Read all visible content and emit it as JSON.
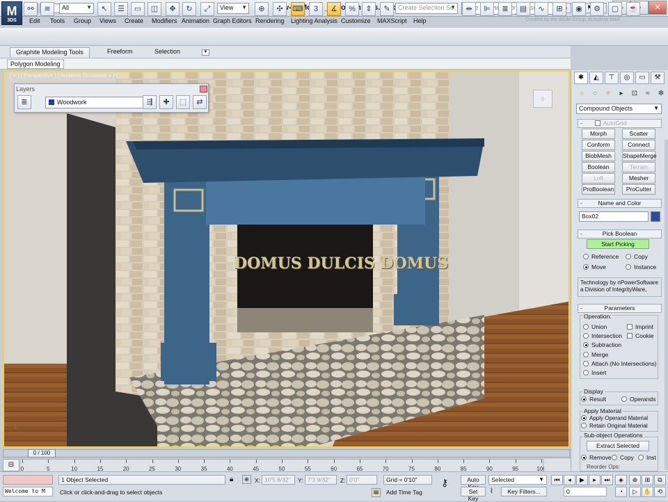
{
  "app": {
    "logo": "M",
    "logo_sub": "3DS",
    "title": "How-to Movie _ Boolean Ops.max",
    "search_placeholder": "Type a keyword or phrase",
    "credit": "Created by the WDM Group, Autodesk M&E"
  },
  "menu": [
    "Edit",
    "Tools",
    "Group",
    "Views",
    "Create",
    "Modifiers",
    "Animation",
    "Graph Editors",
    "Rendering",
    "Lighting Analysis",
    "Customize",
    "MAXScript",
    "Help"
  ],
  "toolbar": {
    "filter": "All",
    "ref_coord": "View",
    "snap_label": "3",
    "selection_set": "Create Selection Se"
  },
  "ribbon": {
    "tabs": [
      "Graphite Modeling Tools",
      "Freeform",
      "Selection"
    ],
    "sub": "Polygon Modeling"
  },
  "viewport": {
    "label": "[ + ] [ Perspective ] [ Ambient Occlusion + H",
    "sign": "DOMUS DULCIS DOMUS"
  },
  "layers": {
    "title": "Layers",
    "current": "Woodwork"
  },
  "panel": {
    "category": "Compound Objects",
    "autogrid": "AutoGrid",
    "buttons": [
      {
        "label": "Morph",
        "enabled": true
      },
      {
        "label": "Scatter",
        "enabled": true
      },
      {
        "label": "Conform",
        "enabled": true
      },
      {
        "label": "Connect",
        "enabled": true
      },
      {
        "label": "BlobMesh",
        "enabled": true
      },
      {
        "label": "ShapeMerge",
        "enabled": true
      },
      {
        "label": "Boolean",
        "enabled": true
      },
      {
        "label": "Terrain",
        "enabled": false
      },
      {
        "label": "Loft",
        "enabled": false
      },
      {
        "label": "Mesher",
        "enabled": true
      },
      {
        "label": "ProBoolean",
        "enabled": true
      },
      {
        "label": "ProCutter",
        "enabled": true
      }
    ],
    "name_color_header": "Name and Color",
    "object_name": "Box02",
    "pick_header": "Pick Boolean",
    "start_picking": "Start Picking",
    "pick_modes": {
      "reference": "Reference",
      "copy": "Copy",
      "move": "Move",
      "instance": "Instance"
    },
    "tech_note": "Technology by nPowerSoftware a Division of IntegrityWare,",
    "params_header": "Parameters",
    "operation_label": "Operation:",
    "operations": [
      "Union",
      "Intersection",
      "Subtraction",
      "Merge",
      "Attach (No Intersections)",
      "Insert"
    ],
    "selected_operation": "Subtraction",
    "op_checks": [
      "Imprint",
      "Cookie"
    ],
    "display_label": "Display",
    "display_result": "Result",
    "display_operands": "Operands",
    "apply_material_label": "Apply Material",
    "apply_operand": "Apply Operand Material",
    "retain_original": "Retain Original Material",
    "subobj_label": "Sub-object Operations",
    "extract": "Extract Selected",
    "extract_modes": [
      "Remove",
      "Copy",
      "Inst"
    ],
    "reorder": "Reorder Ops:"
  },
  "timeline": {
    "slider": "0 / 100",
    "ticks": [
      "0",
      "5",
      "10",
      "15",
      "20",
      "25",
      "30",
      "35",
      "40",
      "45",
      "50",
      "55",
      "60",
      "65",
      "70",
      "75",
      "80",
      "85",
      "90",
      "95",
      "100"
    ]
  },
  "status": {
    "welcome": "Welcome to M",
    "selected": "1 Object Selected",
    "prompt": "Click or click-and-drag to select objects",
    "x_label": "X:",
    "x": "10'5 8/32\"",
    "y_label": "Y:",
    "y": "7'3 9/32\"",
    "z_label": "Z:",
    "z": "0'0\"",
    "grid": "Grid = 0'10\"",
    "add_time_tag": "Add Time Tag",
    "auto_key": "Auto Key",
    "set_key": "Set Key",
    "key_mode": "Selected",
    "key_filters": "Key Filters...",
    "frame": "0"
  }
}
